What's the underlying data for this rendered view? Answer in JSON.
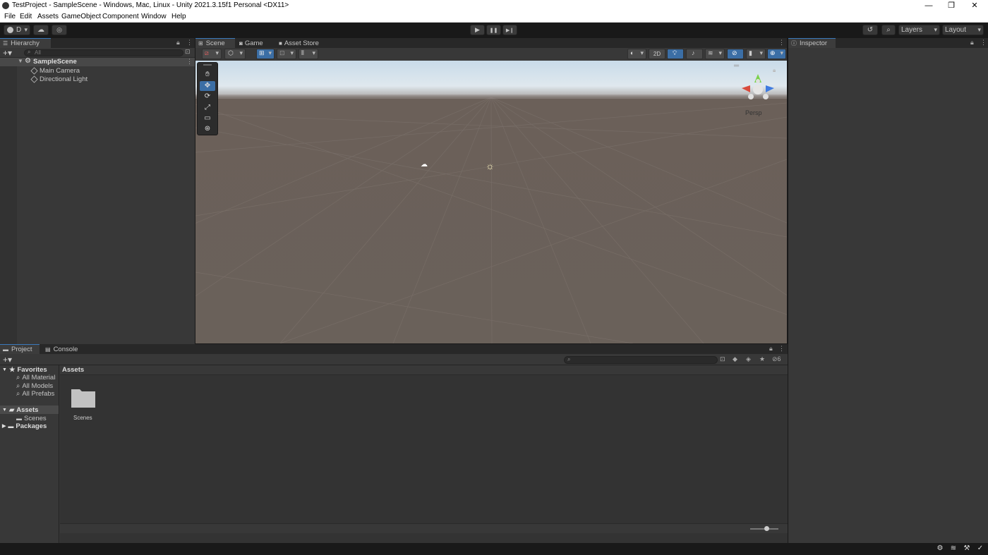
{
  "window": {
    "title": "TestProject - SampleScene - Windows, Mac, Linux - Unity 2021.3.15f1 Personal <DX11>",
    "minimize": "—",
    "maximize": "❐",
    "close": "✕"
  },
  "menu": [
    "File",
    "Edit",
    "Assets",
    "GameObject",
    "Component",
    "Window",
    "Help"
  ],
  "toolbar": {
    "account_label": "D",
    "layers_label": "Layers",
    "layout_label": "Layout",
    "play_icon": "▶",
    "pause_icon": "❚❚",
    "step_icon": "▶❙"
  },
  "hierarchy": {
    "tab_label": "Hierarchy",
    "search_placeholder": "All",
    "scene_name": "SampleScene",
    "items": [
      "Main Camera",
      "Directional Light"
    ]
  },
  "scene": {
    "tabs": [
      "Scene",
      "Game",
      "Asset Store"
    ],
    "mode_2d_label": "2D",
    "persp_label": "Persp"
  },
  "inspector": {
    "tab_label": "Inspector"
  },
  "project": {
    "tabs": [
      "Project",
      "Console"
    ],
    "favorites_label": "Favorites",
    "favorites": [
      "All Materials",
      "All Models",
      "All Prefabs"
    ],
    "assets_label": "Assets",
    "assets_children": [
      "Scenes"
    ],
    "packages_label": "Packages",
    "breadcrumb": "Assets",
    "folders": [
      "Scenes"
    ],
    "hidden_packages_count": "6"
  }
}
